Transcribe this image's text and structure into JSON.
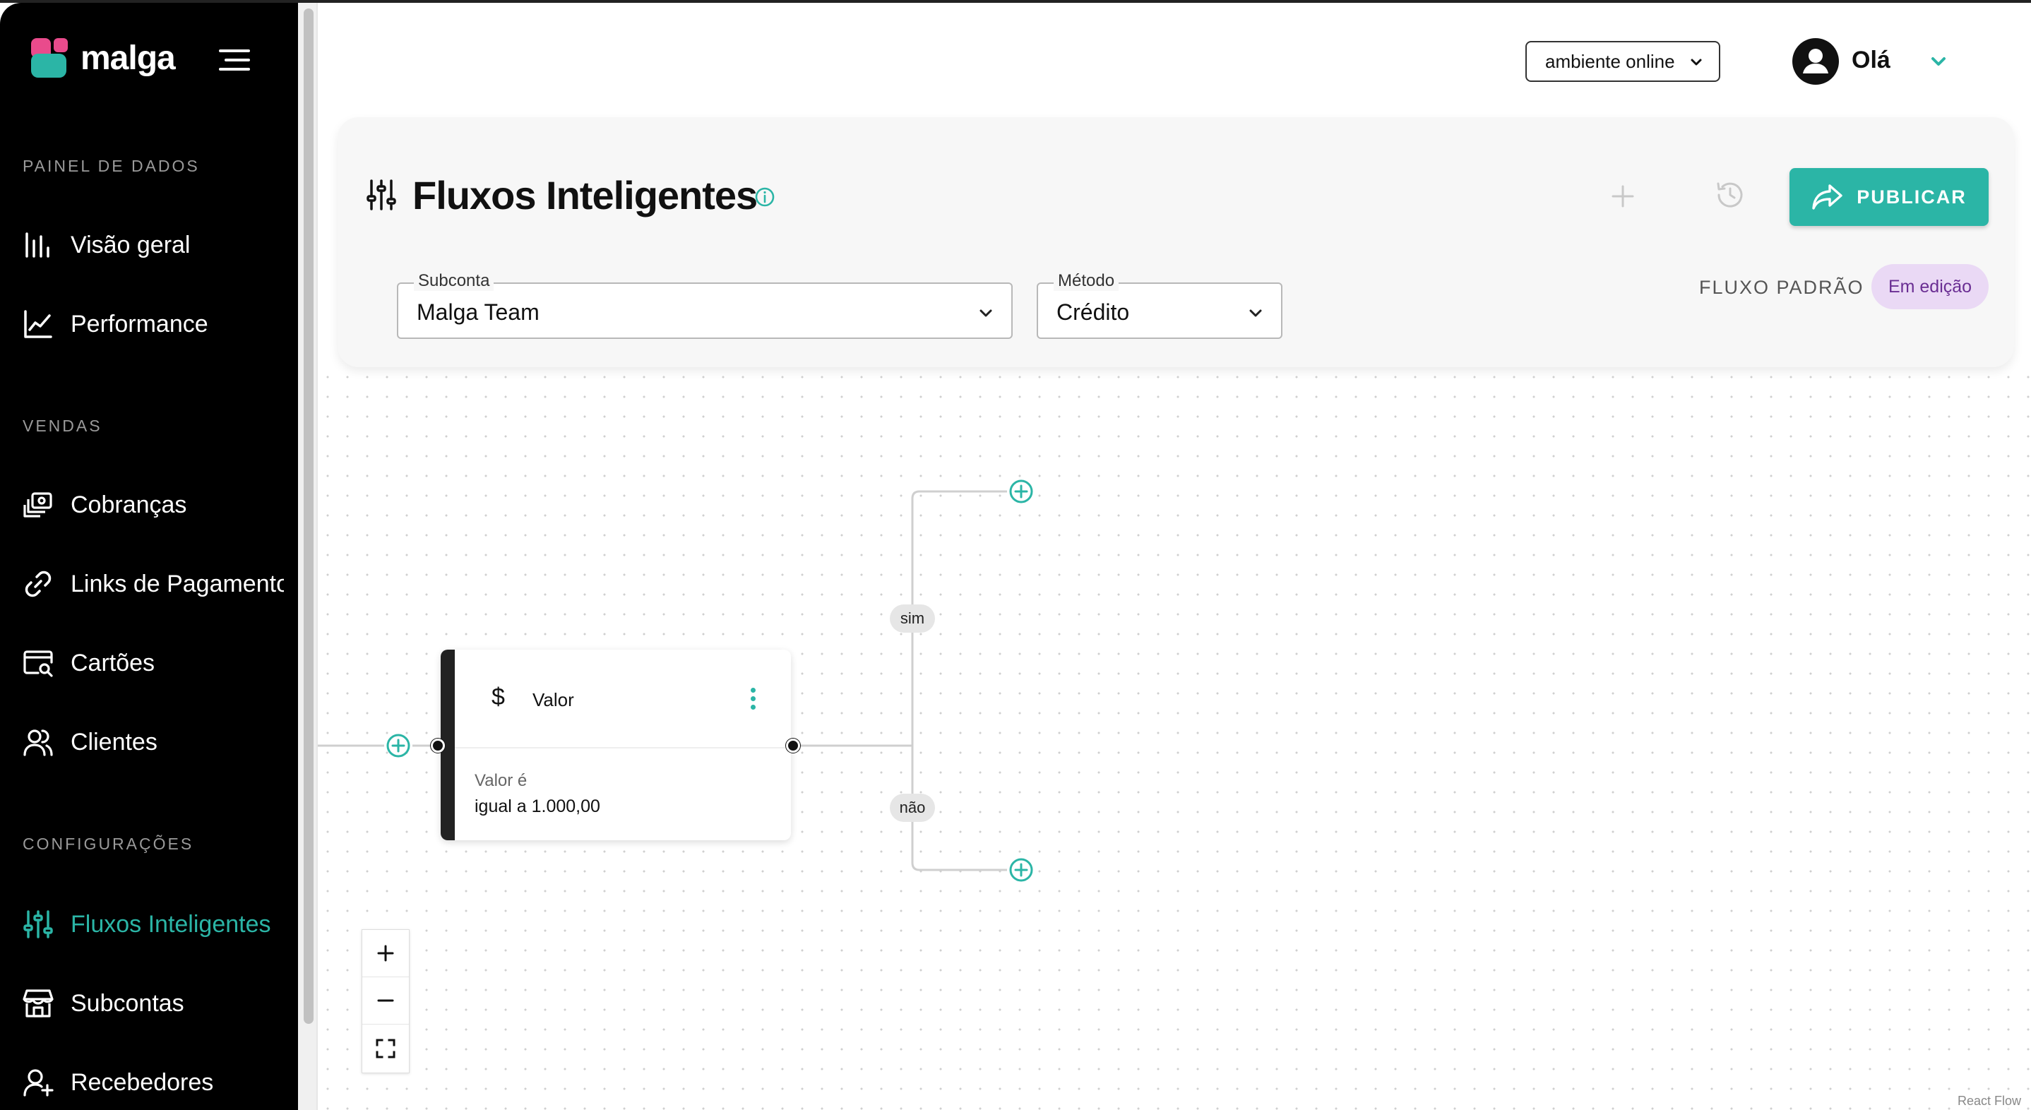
{
  "brand": {
    "name": "malga",
    "colors": {
      "pink": "#e94b8c",
      "teal": "#2bb5a6"
    }
  },
  "sidebar": {
    "sections": [
      {
        "title": "PAINEL DE DADOS"
      },
      {
        "title": "VENDAS"
      },
      {
        "title": "CONFIGURAÇÕES"
      }
    ],
    "items": [
      {
        "label": "Visão geral",
        "icon": "bar-chart-icon"
      },
      {
        "label": "Performance",
        "icon": "line-chart-icon"
      },
      {
        "label": "Cobranças",
        "icon": "charges-icon"
      },
      {
        "label": "Links de Pagamento",
        "icon": "link-icon"
      },
      {
        "label": "Cartões",
        "icon": "card-search-icon"
      },
      {
        "label": "Clientes",
        "icon": "users-icon"
      },
      {
        "label": "Fluxos Inteligentes",
        "icon": "sliders-icon",
        "active": true
      },
      {
        "label": "Subcontas",
        "icon": "store-icon"
      },
      {
        "label": "Recebedores",
        "icon": "user-plus-icon"
      }
    ]
  },
  "header": {
    "environment": "ambiente online",
    "greeting": "Olá"
  },
  "panel": {
    "title": "Fluxos Inteligentes",
    "publish_label": "PUBLICAR",
    "subconta": {
      "label": "Subconta",
      "value": "Malga Team"
    },
    "metodo": {
      "label": "Método",
      "value": "Crédito"
    },
    "flow_label": "FLUXO PADRÃO",
    "status_badge": "Em edição"
  },
  "flow": {
    "node": {
      "title": "Valor",
      "condition_label": "Valor é",
      "condition_value": "igual a 1.000,00"
    },
    "branch_yes": "sim",
    "branch_no": "não",
    "attribution": "React Flow"
  }
}
